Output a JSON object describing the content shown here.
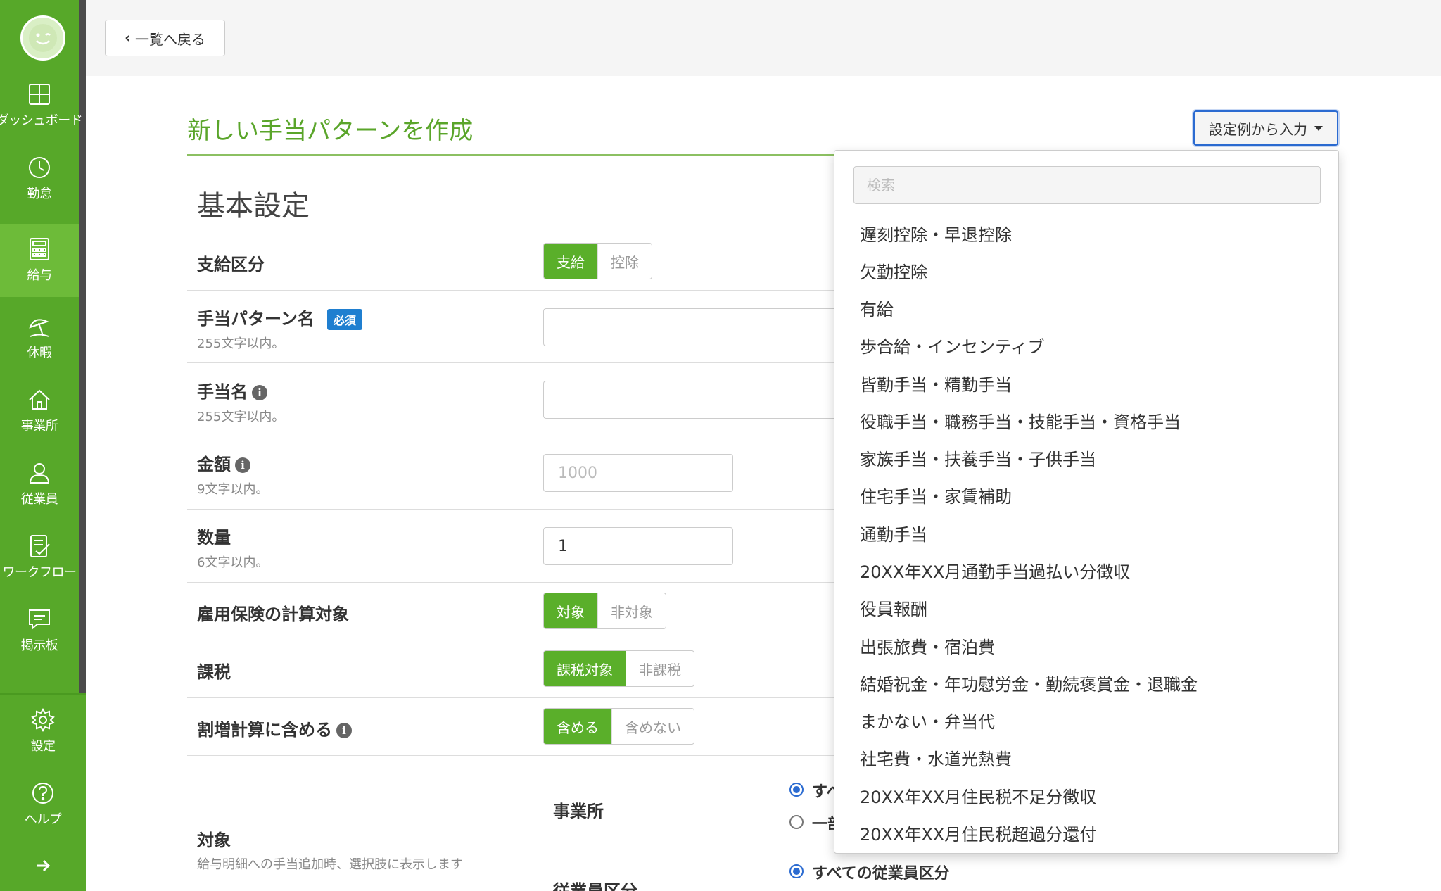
{
  "nav": {
    "items": [
      {
        "label": "ダッシュボード",
        "icon": "dashboard-icon"
      },
      {
        "label": "勤怠",
        "icon": "clock-icon"
      },
      {
        "label": "給与",
        "icon": "calculator-icon"
      },
      {
        "label": "休暇",
        "icon": "beach-umbrella-icon"
      },
      {
        "label": "事業所",
        "icon": "home-icon"
      },
      {
        "label": "従業員",
        "icon": "user-icon"
      },
      {
        "label": "ワークフロー",
        "icon": "checklist-icon"
      },
      {
        "label": "掲示板",
        "icon": "chat-icon"
      }
    ],
    "bottom": [
      {
        "label": "設定",
        "icon": "gear-icon"
      },
      {
        "label": "ヘルプ",
        "icon": "help-icon"
      }
    ],
    "active_index": 2
  },
  "topbar": {
    "back_label": "一覧へ戻る"
  },
  "page": {
    "title": "新しい手当パターンを作成",
    "example_button": "設定例から入力",
    "section_title": "基本設定"
  },
  "form": {
    "payment_type": {
      "label": "支給区分",
      "options": [
        "支給",
        "控除"
      ]
    },
    "pattern_name": {
      "label": "手当パターン名",
      "required": "必須",
      "hint": "255文字以内。",
      "value": ""
    },
    "allowance_name": {
      "label": "手当名",
      "hint": "255文字以内。",
      "value": ""
    },
    "amount": {
      "label": "金額",
      "hint": "9文字以内。",
      "placeholder": "1000"
    },
    "quantity": {
      "label": "数量",
      "hint": "6文字以内。",
      "value": "1"
    },
    "employment_insurance": {
      "label": "雇用保険の計算対象",
      "options": [
        "対象",
        "非対象"
      ]
    },
    "taxation": {
      "label": "課税",
      "options": [
        "課税対象",
        "非課税"
      ]
    },
    "overtime": {
      "label": "割増計算に含める",
      "options": [
        "含める",
        "含めない"
      ]
    },
    "target": {
      "label": "対象",
      "hint": "給与明細への手当追加時、選択肢に表示します",
      "office_label": "事業所",
      "office_opt1": "すべ",
      "office_opt2": "一部",
      "employee_type_label": "従業員区分",
      "employee_type_opt1": "すべての従業員区分"
    }
  },
  "dropdown": {
    "search_placeholder": "検索",
    "items": [
      "遅刻控除・早退控除",
      "欠勤控除",
      "有給",
      "歩合給・インセンティブ",
      "皆勤手当・精勤手当",
      "役職手当・職務手当・技能手当・資格手当",
      "家族手当・扶養手当・子供手当",
      "住宅手当・家賃補助",
      "通勤手当",
      "20XX年XX月通勤手当過払い分徴収",
      "役員報酬",
      "出張旅費・宿泊費",
      "結婚祝金・年功慰労金・勤続褒賞金・退職金",
      "まかない・弁当代",
      "社宅費・水道光熱費",
      "20XX年XX月住民税不足分徴収",
      "20XX年XX月住民税超過分還付"
    ]
  },
  "colors": {
    "brand_green": "#57a829",
    "active_green": "#6dbb39",
    "accent_blue": "#2b6bd1"
  }
}
